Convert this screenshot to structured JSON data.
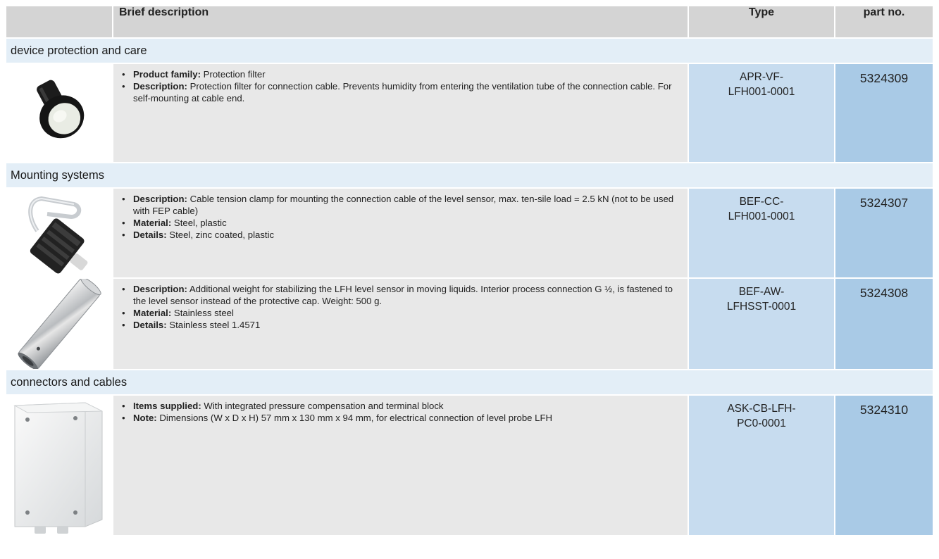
{
  "header": {
    "brief_description": "Brief description",
    "type": "Type",
    "part_no": "part no."
  },
  "sections": [
    {
      "title": "device protection and care",
      "items": [
        {
          "image_icon": "protection-filter-icon",
          "bullets": [
            {
              "label": "Product family:",
              "text": " Protection filter"
            },
            {
              "label": "Description:",
              "text": " Protection filter for connection cable. Prevents humidity from entering the ventilation tube of the connection cable. For self-mounting at cable end."
            }
          ],
          "type_line1": "APR-VF-",
          "type_line2": "LFH001-0001",
          "part_no": "5324309"
        }
      ]
    },
    {
      "title": "Mounting systems",
      "items": [
        {
          "image_icon": "cable-tension-clamp-icon",
          "bullets": [
            {
              "label": "Description:",
              "text": " Cable tension clamp for mounting the connection cable of the level sensor, max. ten-sile load = 2.5 kN (not to be used with FEP cable)"
            },
            {
              "label": "Material:",
              "text": " Steel, plastic"
            },
            {
              "label": "Details:",
              "text": " Steel, zinc coated, plastic"
            }
          ],
          "type_line1": "BEF-CC-",
          "type_line2": "LFH001-0001",
          "part_no": "5324307"
        },
        {
          "image_icon": "additional-weight-icon",
          "bullets": [
            {
              "label": "Description:",
              "text": " Additional weight for stabilizing the LFH level sensor in moving liquids. Interior process connection G ½, is fastened to the level sensor instead of the protective cap. Weight: 500 g."
            },
            {
              "label": "Material:",
              "text": " Stainless steel"
            },
            {
              "label": "Details:",
              "text": " Stainless steel 1.4571"
            }
          ],
          "type_line1": "BEF-AW-",
          "type_line2": "LFHSST-0001",
          "part_no": "5324308"
        }
      ]
    },
    {
      "title": "connectors and cables",
      "items": [
        {
          "image_icon": "connection-box-icon",
          "bullets": [
            {
              "label": "Items supplied:",
              "text": " With integrated pressure compensation and terminal block"
            },
            {
              "label": "Note:",
              "text": " Dimensions (W x D x H) 57 mm x 130 mm x 94 mm, for electrical connection of level probe LFH"
            }
          ],
          "type_line1": "ASK-CB-LFH-",
          "type_line2": "PC0-0001",
          "part_no": "5324310"
        }
      ]
    }
  ]
}
